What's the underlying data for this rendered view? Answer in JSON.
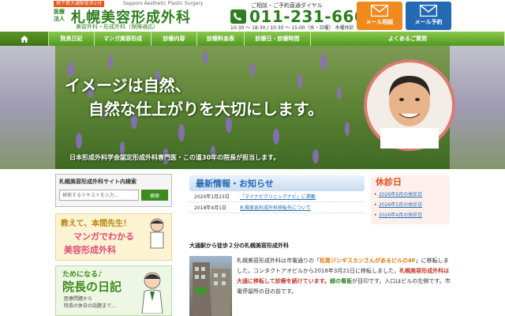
{
  "header": {
    "station_badge": "地下鉄大通駅徒歩2分",
    "brand_en": "Sapporo Aesthetic Plastic Surgery",
    "corp_tag": "医療法人",
    "clinic_name": "札幌美容形成外科",
    "clinic_sub": "美容外科・形成外科（保険適応）",
    "tel_caption": "ご相談・ご予約直通ダイヤル",
    "tel_number": "011-231-6666",
    "hours": "10:30 ～ 18:30 / 10:30 ～ 15:00（水・日曜） 木曜休診",
    "consult_button": "メール相談",
    "reserve_button": "メール予約"
  },
  "nav": {
    "items": [
      "院長日記",
      "マンガ美容形成",
      "診療内容",
      "診療料金表",
      "診療日・診療時間",
      "よくあるご質問"
    ]
  },
  "hero": {
    "catch1": "イメージは自然、",
    "catch2": "自然な仕上がりを大切にします。",
    "cert_line": "日本形成外科学会認定形成外科専門医・この道30年の院長が担当します。"
  },
  "sidebar": {
    "search_title": "札幌美容形成外科サイト内検索",
    "search_placeholder": "検索するテキストを入力...",
    "search_button": "検索",
    "manga_top": "教えて、本間先生！",
    "manga_line1": "マンガでわかる",
    "manga_line2": "美容形成外科",
    "diary_top": "ためになる♪",
    "diary_title": "院長の日記",
    "diary_sub1": "医療問題から",
    "diary_sub2": "院長の休日の話題まで…"
  },
  "news": {
    "title": "最新情報・お知らせ",
    "items": [
      {
        "date": "2020年1月23日",
        "text": "「マイナビクリニックナビ」に掲載"
      },
      {
        "date": "2018年4月1日",
        "text": "札幌美容形成外科移転先について"
      }
    ]
  },
  "holidays": {
    "title": "休診日",
    "items": [
      "2026年6月の休診日",
      "2026年5月の休診日",
      "2026年4月の休診日"
    ]
  },
  "access": {
    "heading": "大通駅から徒歩２分の札幌美容形成外科",
    "p1_a": "札幌美容形成外科は市電通りの「",
    "p1_b": "松尾ジンギスカンさんがあるビルの4F",
    "p1_c": "」に移転しました。コンタクトアオビルから2018年3月21日に移転しました。",
    "p2_a": "札幌美容形成外科は大通に移転して診療を続けています。",
    "p3_a": "緑の看板",
    "p3_b": "が目印です。入口はビルの左側です。市電停留所の目の前です。"
  },
  "colors": {
    "brand_green": "#2e7d1f",
    "nav_green": "#6cb233",
    "consult_orange": "#f08a1c",
    "reserve_blue": "#2469b4",
    "holiday_red": "#e04b1a"
  },
  "icons": [
    "phone-icon",
    "mail-icon",
    "home-icon",
    "search-icon"
  ]
}
